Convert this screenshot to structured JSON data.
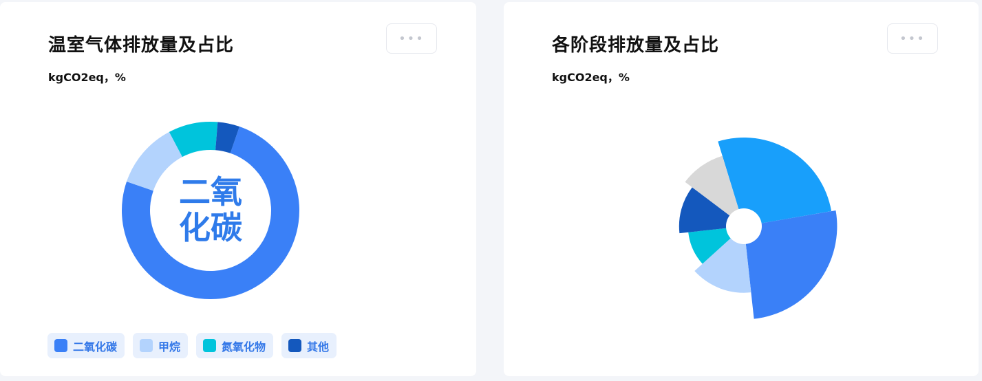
{
  "cards": [
    {
      "title": "温室气体排放量及占比",
      "unit": "kgCO2eq，%",
      "more_label": "•••",
      "center_label_line1": "二氧",
      "center_label_line2": "化碳",
      "legend": [
        {
          "label": "二氧化碳",
          "color": "#3a80f7"
        },
        {
          "label": "甲烷",
          "color": "#b3d3fd"
        },
        {
          "label": "氮氧化物",
          "color": "#00c4dc"
        },
        {
          "label": "其他",
          "color": "#1458bd"
        }
      ]
    },
    {
      "title": "各阶段排放量及占比",
      "unit": "kgCO2eq，%",
      "more_label": "•••"
    }
  ],
  "colors": {
    "center_text": "#2f7bea",
    "pie_gray": "#d8d8d8",
    "pie_sky": "#189ffb"
  },
  "chart_data": [
    {
      "type": "pie",
      "variant": "donut",
      "categories": [
        "二氧化碳",
        "甲烷",
        "氮氧化物",
        "其他"
      ],
      "values": [
        75,
        12,
        9,
        4
      ],
      "unit": "%",
      "colors": [
        "#3a80f7",
        "#b3d3fd",
        "#00c4dc",
        "#1458bd"
      ],
      "start_angle_deg": 19,
      "direction": "clockwise"
    },
    {
      "type": "pie",
      "variant": "rose",
      "slices": [
        {
          "value": 27,
          "relative_radius": 1.0,
          "color": "#189ffb"
        },
        {
          "value": 26,
          "relative_radius": 1.05,
          "color": "#3a80f7"
        },
        {
          "value": 15,
          "relative_radius": 0.75,
          "color": "#b3d3fd"
        },
        {
          "value": 10,
          "relative_radius": 0.63,
          "color": "#00c4dc"
        },
        {
          "value": 12,
          "relative_radius": 0.73,
          "color": "#1458bd"
        },
        {
          "value": 10,
          "relative_radius": 0.83,
          "color": "#d8d8d8"
        }
      ],
      "start_angle_deg": -17,
      "direction": "clockwise",
      "unit": "%"
    }
  ]
}
